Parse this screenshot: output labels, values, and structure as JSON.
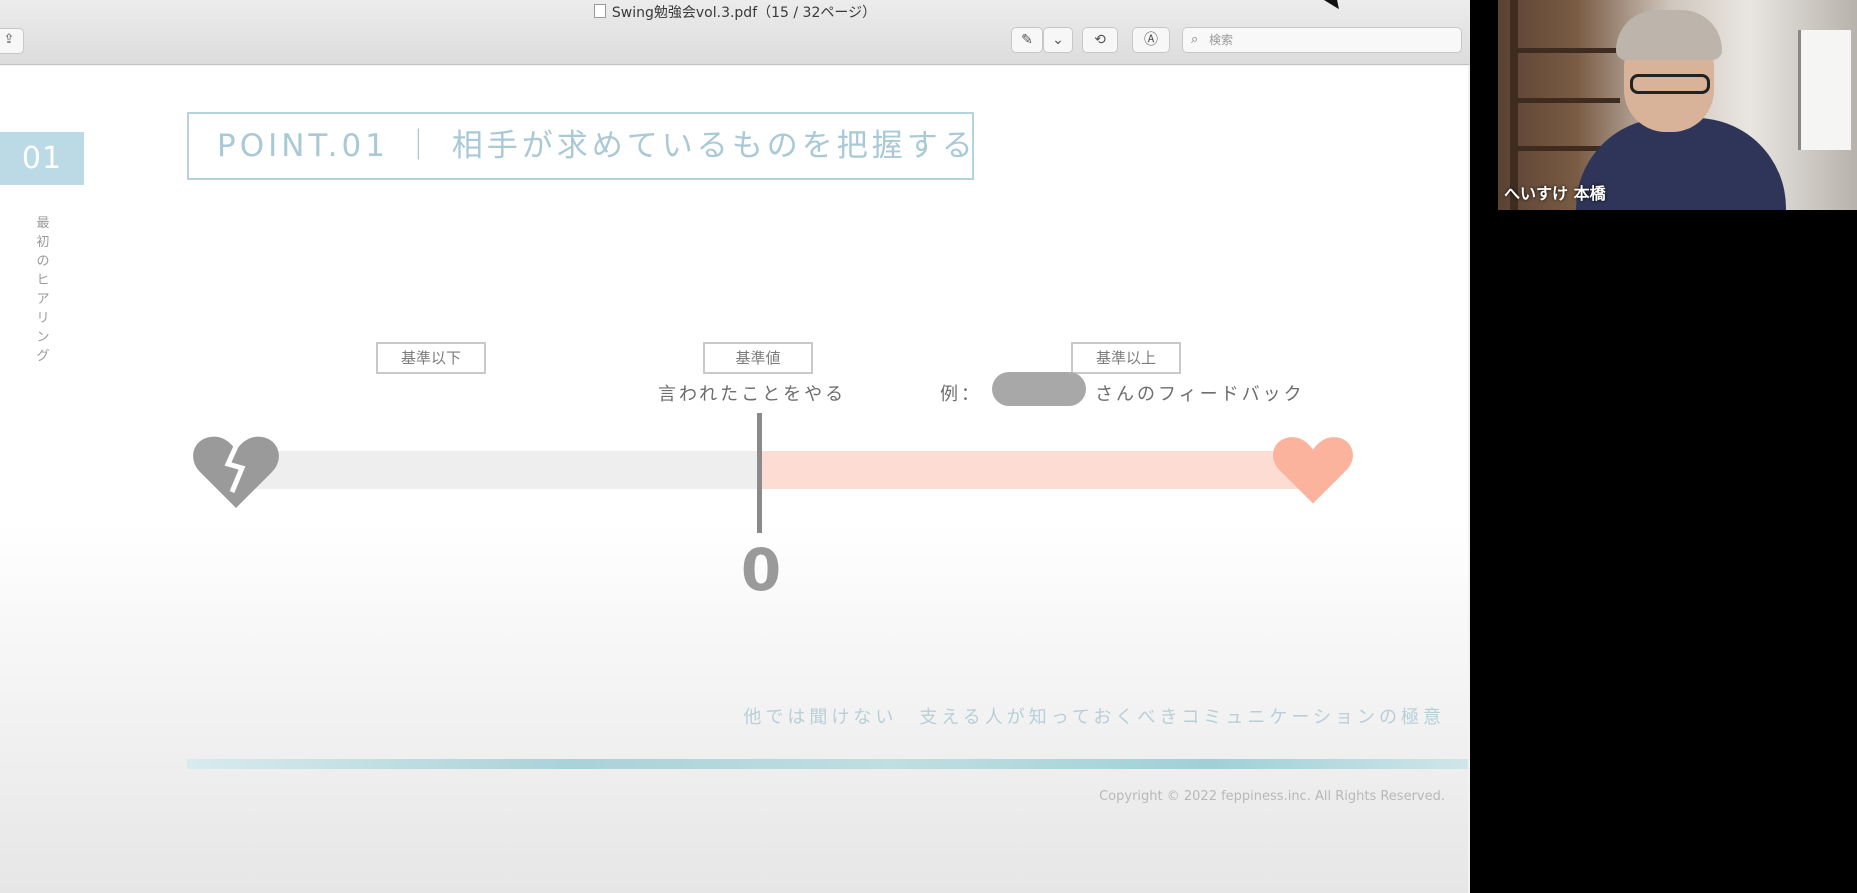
{
  "window": {
    "title": "Swing勉強会vol.3.pdf（15 / 32ページ）"
  },
  "toolbar": {
    "search_placeholder": "検索"
  },
  "slide": {
    "section_number": "01",
    "vertical_label": "最初のヒアリング",
    "point_title": "POINT.01 ｜ 相手が求めているものを把握する",
    "tags": {
      "below": "基準以下",
      "baseline": "基準値",
      "above": "基準以上"
    },
    "captions": {
      "baseline": "言われたことをやる",
      "above_prefix": "例：",
      "above_suffix": "さんのフィードバック"
    },
    "zero_value": "0",
    "tagline": "他では聞けない　支える人が知っておくべきコミュニケーションの極意",
    "copyright": "Copyright © 2022 feppiness.inc. All Rights Reserved."
  },
  "participant": {
    "name": "へいすけ 本橋"
  },
  "colors": {
    "accent_blue": "#bcd9e6",
    "heart_pink": "#fbb39e",
    "broken_heart_grey": "#9a9a9a"
  },
  "icons": [
    "document-icon",
    "share-icon",
    "pen-icon",
    "chevron-down-icon",
    "rotate-icon",
    "markup-icon",
    "search-icon",
    "broken-heart-icon",
    "heart-icon"
  ]
}
